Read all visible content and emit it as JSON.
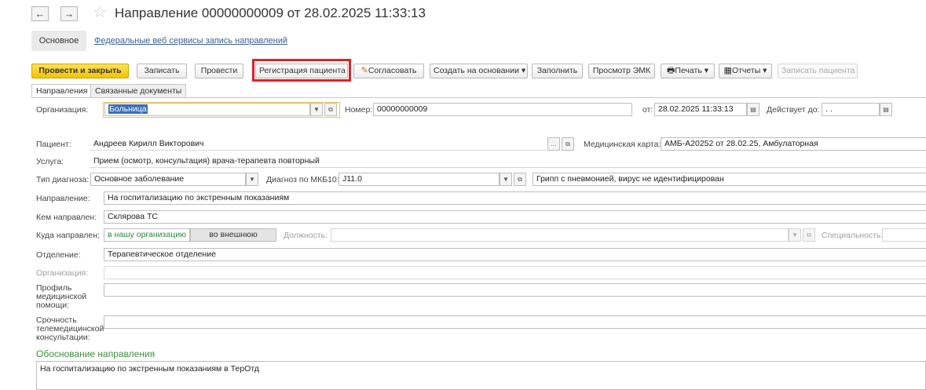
{
  "header": {
    "back_glyph": "←",
    "forward_glyph": "→",
    "favorite_icon": "star-icon",
    "title": "Направление 00000000009 от 28.02.2025 11:33:13"
  },
  "sections": {
    "main": "Основное",
    "link": "Федеральные веб сервисы запись направлений"
  },
  "toolbar": {
    "post_close": "Провести и закрыть",
    "save": "Записать",
    "post": "Провести",
    "register_patient": "Регистрация пациента",
    "agree": "Согласовать",
    "create_based": "Создать на основании",
    "fill": "Заполнить",
    "view_emk": "Просмотр ЭМК",
    "print": "Печать",
    "reports": "Отчеты",
    "record_patient": "Записать пациента",
    "dropdown_glyph": "▾",
    "highlight_color": "#e0202a"
  },
  "tabs": [
    {
      "label": "Направления",
      "active": true
    },
    {
      "label": "Связанные документы",
      "active": false
    }
  ],
  "form": {
    "org_label": "Организация:",
    "org_value": "Больница",
    "number_label": "Номер:",
    "number_value": "00000000009",
    "from_label": "от:",
    "from_value": "28.02.2025 11:33:13",
    "valid_label": "Действует до:",
    "valid_value": ". .",
    "patient_label": "Пациент:",
    "patient_value": "Андреев Кирилл Викторович",
    "card_label": "Медицинская карта:",
    "card_value": "АМБ-А20252 от 28.02.25, Амбулаторная",
    "service_label": "Услуга:",
    "service_value": "Прием (осмотр, консультация) врача-терапевта повторный",
    "diag_type_label": "Тип диагноза:",
    "diag_type_value": "Основное заболевание",
    "mkb_label": "Диагноз по МКБ10:",
    "mkb_value": "J11.0",
    "mkb_desc": "Грипп с пневмонией, вирус не идентифицирован",
    "direction_label": "Направление:",
    "direction_value": "На госпитализацию по экстренным показаниям",
    "by_whom_label": "Кем направлен:",
    "by_whom_value": "Склярова ТС",
    "where_label": "Куда направлен:",
    "where_internal": "в нашу организацию",
    "where_external": "во внешнюю",
    "position_label": "Должность:",
    "specialty_label": "Специальность:",
    "department_label": "Отделение:",
    "department_value": "Терапевтическое отделение",
    "org2_label": "Организация:",
    "profile_label_1": "Профиль",
    "profile_label_2": "медицинской",
    "profile_label_3": "помощи:",
    "urgency_label_1": "Срочность",
    "urgency_label_2": "телемедицинской",
    "urgency_label_3": "консультации:",
    "justification_title": "Обоснование направления",
    "justification_value": "На госпитализацию по экстренным показаниям в ТерОтд"
  }
}
